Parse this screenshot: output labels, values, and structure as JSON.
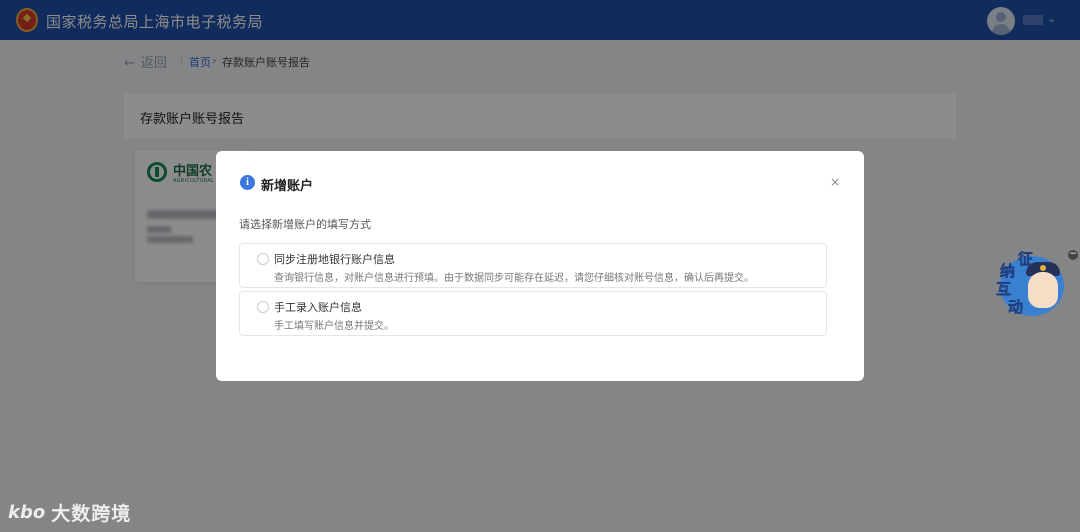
{
  "header": {
    "app_title": "国家税务总局上海市电子税务局",
    "logo_icon": "tax-emblem-icon",
    "avatar_icon": "user-avatar-icon",
    "chevron_icon": "chevron-down-icon"
  },
  "breadcrumb": {
    "back_label": "返回",
    "back_icon": "arrow-left-icon",
    "home_label": "首页",
    "separator": "›",
    "current_label": "存款账户账号报告"
  },
  "page": {
    "title": "存款账户账号报告"
  },
  "bank_card": {
    "bank_name": "中国农",
    "bank_name_en": "AGRICULTURAL BANK",
    "logo_icon": "abc-bank-logo-icon"
  },
  "modal": {
    "info_icon": "i",
    "title": "新增账户",
    "close_label": "×",
    "prompt": "请选择新增账户的填写方式",
    "options": [
      {
        "title": "同步注册地银行账户信息",
        "description": "查询银行信息，对账户信息进行预填。由于数据同步可能存在延迟，请您仔细核对账号信息，确认后再提交。",
        "selected": false
      },
      {
        "title": "手工录入账户信息",
        "description": "手工填写账户信息并提交。",
        "selected": false
      }
    ]
  },
  "mascot": {
    "chars": [
      "征",
      "纳",
      "互",
      "动"
    ],
    "minimize_label": "−"
  },
  "watermark": {
    "logo": "kbo",
    "text": "大数跨境"
  },
  "colors": {
    "header_bg": "#1f4fa8",
    "link": "#3a6fd8",
    "info_icon": "#3a78e0",
    "bank_green": "#1a6e47"
  }
}
